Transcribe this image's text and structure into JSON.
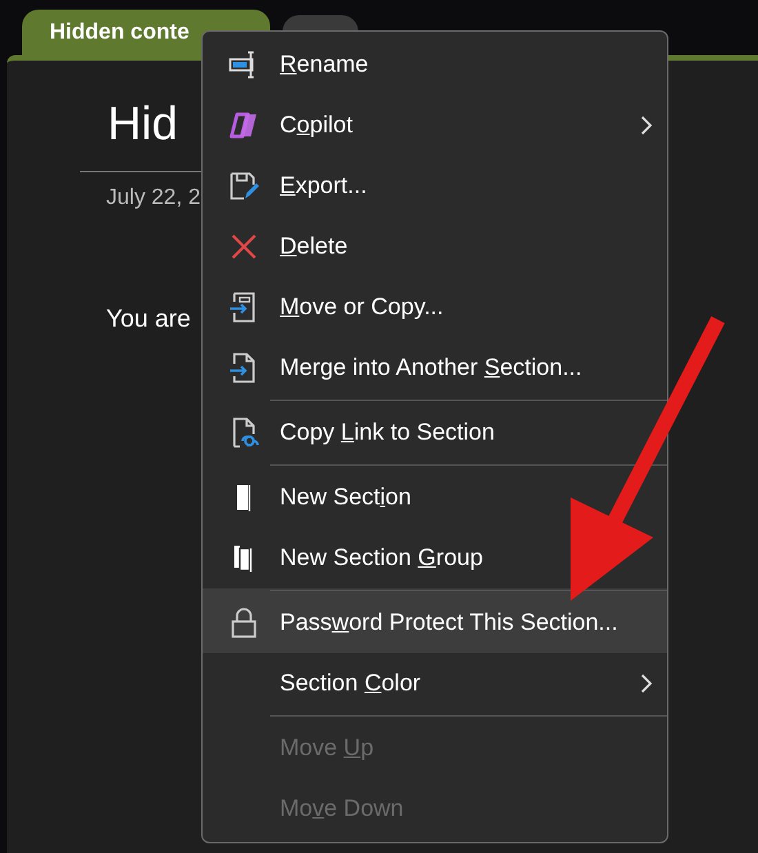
{
  "tabs": [
    {
      "label": "Hidden conte",
      "selected": true
    },
    {
      "selected": false
    }
  ],
  "page": {
    "title": "Hid",
    "date": "July 22, 2",
    "body": "You are"
  },
  "context_menu": {
    "items": [
      {
        "key": "R",
        "after": "ename",
        "disabled": false,
        "selected": false,
        "submenu": false,
        "divider_above": false
      },
      {
        "before": "C",
        "key": "o",
        "after": "pilot",
        "disabled": false,
        "selected": false,
        "submenu": true,
        "divider_above": false
      },
      {
        "key": "E",
        "after": "xport...",
        "disabled": false,
        "selected": false,
        "submenu": false,
        "divider_above": false
      },
      {
        "key": "D",
        "after": "elete",
        "disabled": false,
        "selected": false,
        "submenu": false,
        "divider_above": false
      },
      {
        "key": "M",
        "after": "ove or Copy...",
        "disabled": false,
        "selected": false,
        "submenu": false,
        "divider_above": false
      },
      {
        "before": "Merge into Another ",
        "key": "S",
        "after": "ection...",
        "disabled": false,
        "selected": false,
        "submenu": false,
        "divider_above": false
      },
      {
        "before": "Copy ",
        "key": "L",
        "after": "ink to Section",
        "disabled": false,
        "selected": false,
        "submenu": false,
        "divider_above": true
      },
      {
        "before": "New Sect",
        "key": "i",
        "after": "on",
        "disabled": false,
        "selected": false,
        "submenu": false,
        "divider_above": true
      },
      {
        "before": "New Section ",
        "key": "G",
        "after": "roup",
        "disabled": false,
        "selected": false,
        "submenu": false,
        "divider_above": false
      },
      {
        "before": "Pass",
        "key": "w",
        "after": "ord Protect This Section...",
        "disabled": false,
        "selected": true,
        "submenu": false,
        "divider_above": true
      },
      {
        "before": "Section ",
        "key": "C",
        "after": "olor",
        "disabled": false,
        "selected": false,
        "submenu": true,
        "divider_above": false
      },
      {
        "before": "Move ",
        "key": "U",
        "after": "p",
        "disabled": true,
        "selected": false,
        "submenu": false,
        "divider_above": true
      },
      {
        "before": "Mo",
        "key": "v",
        "after": "e Down",
        "disabled": true,
        "selected": false,
        "submenu": false,
        "divider_above": false
      }
    ]
  }
}
